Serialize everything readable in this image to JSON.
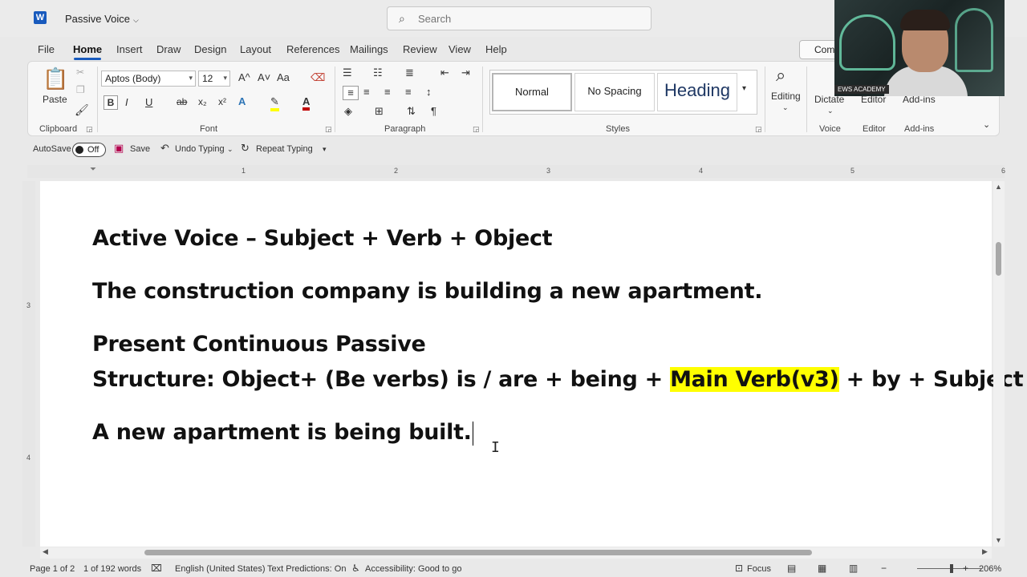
{
  "app": {
    "logo": "W",
    "doc_title": "Passive Voice"
  },
  "search": {
    "placeholder": "Search"
  },
  "menu": {
    "tabs": [
      "File",
      "Home",
      "Insert",
      "Draw",
      "Design",
      "Layout",
      "References",
      "Mailings",
      "Review",
      "View",
      "Help"
    ],
    "active": "Home",
    "comments_label": "Com"
  },
  "ribbon": {
    "clipboard": {
      "paste_label": "Paste",
      "group_label": "Clipboard"
    },
    "font": {
      "font_name": "Aptos (Body)",
      "font_size": "12",
      "group_label": "Font",
      "bold": "B",
      "italic": "I",
      "underline": "U",
      "strike": "ab",
      "sub": "x₂",
      "sup": "x²",
      "grow": "A^",
      "shrink": "A˅",
      "case": "Aa"
    },
    "paragraph": {
      "group_label": "Paragraph",
      "pilcrow": "¶"
    },
    "styles": {
      "group_label": "Styles",
      "items": [
        "Normal",
        "No Spacing",
        "Heading"
      ]
    },
    "editing": {
      "label": "Editing"
    },
    "voice": {
      "dictate_label": "Dictate",
      "group_label": "Voice"
    },
    "editor": {
      "label": "Editor",
      "group_label": "Editor"
    },
    "addins": {
      "label": "Add-ins",
      "group_label": "Add-ins"
    }
  },
  "qat": {
    "autosave_label": "AutoSave",
    "autosave_state": "Off",
    "save_label": "Save",
    "undo_label": "Undo Typing",
    "repeat_label": "Repeat Typing"
  },
  "ruler": {
    "numbers": [
      "1",
      "2",
      "3",
      "4",
      "5",
      "6"
    ],
    "vnumbers": [
      "3",
      "4"
    ]
  },
  "document": {
    "line1": "Active Voice – Subject + Verb + Object",
    "line2": "The construction company is building a new apartment.",
    "line3": "Present Continuous Passive",
    "line4_before": "Structure: Object+ (Be verbs) is / are + being + ",
    "line4_highlight": "Main Verb(v3)",
    "line4_after": " + by + Subject",
    "line5": "A new apartment is being built."
  },
  "status": {
    "page": "Page 1 of 2",
    "words": "1 of 192 words",
    "language": "English (United States)",
    "predictions": "Text Predictions: On",
    "accessibility": "Accessibility: Good to go",
    "focus": "Focus",
    "zoom": "206%"
  },
  "webcam": {
    "tag": "EWS ACADEMY"
  },
  "colors": {
    "accent": "#185abd",
    "highlight": "#ffff00"
  }
}
